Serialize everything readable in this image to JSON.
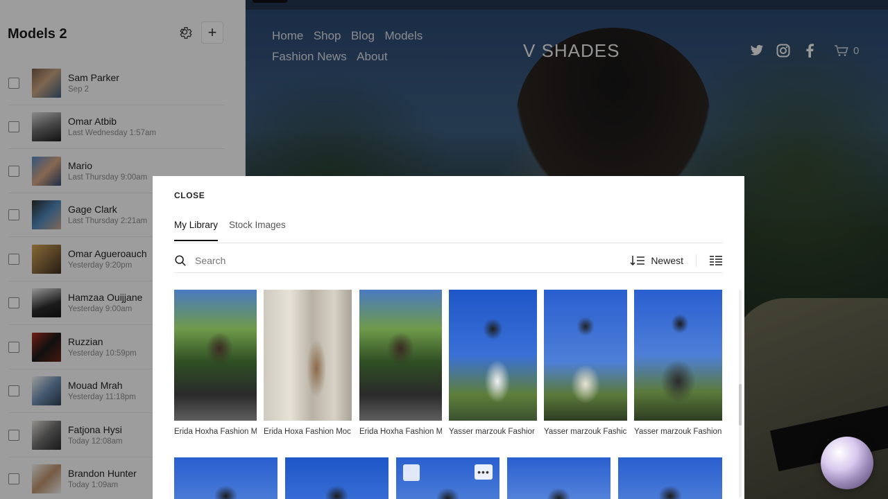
{
  "sidebar": {
    "title": "Models 2",
    "items": [
      {
        "name": "Sam Parker",
        "date": "Sep 2"
      },
      {
        "name": "Omar Atbib",
        "date": "Last Wednesday 1:57am"
      },
      {
        "name": "Mario",
        "date": "Last Thursday 9:00am"
      },
      {
        "name": "Gage Clark",
        "date": "Last Thursday 2:21am"
      },
      {
        "name": "Omar Agueroauch",
        "date": "Yesterday 9:20pm"
      },
      {
        "name": "Hamzaa Ouijjane",
        "date": "Yesterday 9:00am"
      },
      {
        "name": "Ruzzian",
        "date": "Yesterday 10:59pm"
      },
      {
        "name": "Mouad Mrah",
        "date": "Yesterday 11:18pm"
      },
      {
        "name": "Fatjona Hysi",
        "date": "Today 12:08am"
      },
      {
        "name": "Brandon Hunter",
        "date": "Today 1:09am"
      }
    ]
  },
  "site": {
    "nav": [
      "Home",
      "Shop",
      "Blog",
      "Models",
      "Fashion News",
      "About"
    ],
    "brand": "V SHADES",
    "cart_count": "0"
  },
  "modal": {
    "close_label": "CLOSE",
    "tabs": [
      "My Library",
      "Stock Images"
    ],
    "search_placeholder": "Search",
    "sort_label": "Newest",
    "images": [
      {
        "caption": "Erida Hoxha Fashion M"
      },
      {
        "caption": "Erida Hoxa Fashion Moc"
      },
      {
        "caption": "Erida Hoxha Fashion M"
      },
      {
        "caption": "Yasser marzouk Fashior"
      },
      {
        "caption": "Yasser marzouk Fashic"
      },
      {
        "caption": "Yasser marzouk Fashion"
      }
    ]
  }
}
